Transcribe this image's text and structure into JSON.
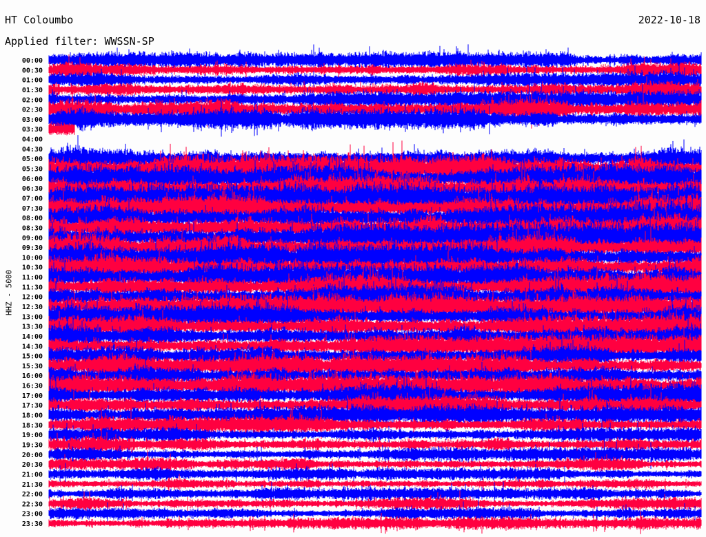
{
  "header": {
    "station": "HT Coloumbo",
    "date": "2022-10-18",
    "filter_label": "Applied filter: WWSSN-SP"
  },
  "chart_data": {
    "type": "line",
    "title": "HT Coloumbo",
    "subtitle": "Applied filter: WWSSN-SP",
    "date": "2022-10-18",
    "ylabel": "HHZ - 5000",
    "xlabel": "",
    "colors": [
      "#0000ff",
      "#ff0040"
    ],
    "rows": [
      {
        "label": "00:00",
        "amp": 9
      },
      {
        "label": "00:30",
        "amp": 9
      },
      {
        "label": "01:00",
        "amp": 9
      },
      {
        "label": "01:30",
        "amp": 10
      },
      {
        "label": "02:00",
        "amp": 10
      },
      {
        "label": "02:30",
        "amp": 14
      },
      {
        "label": "03:00",
        "amp": 12
      },
      {
        "label": "03:30",
        "amp": 10,
        "coverage": 0.04
      },
      {
        "label": "04:00",
        "amp": 0,
        "coverage": 0
      },
      {
        "label": "04:30",
        "amp": 0,
        "coverage": 0
      },
      {
        "label": "05:00",
        "amp": 14
      },
      {
        "label": "05:30",
        "amp": 16
      },
      {
        "label": "06:00",
        "amp": 16
      },
      {
        "label": "06:30",
        "amp": 16
      },
      {
        "label": "07:00",
        "amp": 16
      },
      {
        "label": "07:30",
        "amp": 16
      },
      {
        "label": "08:00",
        "amp": 17
      },
      {
        "label": "08:30",
        "amp": 17
      },
      {
        "label": "09:00",
        "amp": 17
      },
      {
        "label": "09:30",
        "amp": 17
      },
      {
        "label": "10:00",
        "amp": 16
      },
      {
        "label": "10:30",
        "amp": 15
      },
      {
        "label": "11:00",
        "amp": 15
      },
      {
        "label": "11:30",
        "amp": 15
      },
      {
        "label": "12:00",
        "amp": 15
      },
      {
        "label": "12:30",
        "amp": 14
      },
      {
        "label": "13:00",
        "amp": 14
      },
      {
        "label": "13:30",
        "amp": 14
      },
      {
        "label": "14:00",
        "amp": 14
      },
      {
        "label": "14:30",
        "amp": 13
      },
      {
        "label": "15:00",
        "amp": 13
      },
      {
        "label": "15:30",
        "amp": 13
      },
      {
        "label": "16:00",
        "amp": 13
      },
      {
        "label": "16:30",
        "amp": 13
      },
      {
        "label": "17:00",
        "amp": 13
      },
      {
        "label": "17:30",
        "amp": 12
      },
      {
        "label": "18:00",
        "amp": 11
      },
      {
        "label": "18:30",
        "amp": 10
      },
      {
        "label": "19:00",
        "amp": 9
      },
      {
        "label": "19:30",
        "amp": 9
      },
      {
        "label": "20:00",
        "amp": 8
      },
      {
        "label": "20:30",
        "amp": 8
      },
      {
        "label": "21:00",
        "amp": 7
      },
      {
        "label": "21:30",
        "amp": 7
      },
      {
        "label": "22:00",
        "amp": 7
      },
      {
        "label": "22:30",
        "amp": 7
      },
      {
        "label": "23:00",
        "amp": 7
      },
      {
        "label": "23:30",
        "amp": 7
      }
    ]
  }
}
